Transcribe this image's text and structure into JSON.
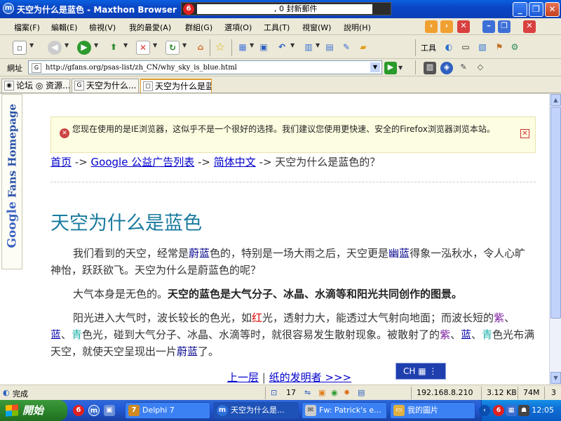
{
  "window": {
    "title": "天空为什么是蓝色 - Maxthon Browser",
    "mail_widget_text": ", 0 封新郵件"
  },
  "menu": {
    "items": [
      "檔案(F)",
      "編輯(E)",
      "檢視(V)",
      "我的最愛(A)",
      "群組(G)",
      "選項(O)",
      "工具(T)",
      "視窗(W)",
      "說明(H)"
    ]
  },
  "toolbar": {
    "tools_label": "工具"
  },
  "address": {
    "label": "網址",
    "url": "http://gfans.org/psas-list/zh_CN/why_sky_is_blue.html"
  },
  "tabs": [
    {
      "label": "论坛 ◎ 资源..."
    },
    {
      "label": "天空为什么..."
    },
    {
      "label": "天空为什么是蓝..."
    }
  ],
  "page": {
    "sidebar_logo_word": "Google",
    "sidebar_logo_rest": " Fans Homepage",
    "ie_warning": "您现在使用的是IE浏览器，这似乎不是一个很好的选择。我们建议您使用更快速、安全的Firefox浏览器浏览本站。",
    "breadcrumb": {
      "home": "首页",
      "arrow": " -> ",
      "list": "Google 公益广告列表",
      "lang": "简体中文",
      "current": "天空为什么是蓝色的？"
    },
    "title": "天空为什么是蓝色",
    "paragraph1": {
      "a": "我们看到的天空，经常是",
      "b": "蔚蓝",
      "c": "色的，特别是一场大雨之后，天空更是",
      "d": "幽蓝",
      "e": "得象一泓秋水，令人心旷神怡，跃跃欲飞。天空为什么是蔚蓝色的呢？"
    },
    "paragraph2": {
      "a": "大气本身是无色的。",
      "b": "天空的",
      "c": "蓝",
      "d": "色是大气分子、冰晶、水滴等和阳光共同创作的图景。"
    },
    "paragraph3": {
      "a": "阳光进入大气时，波长较长的色光，如",
      "b": "红",
      "c": "光，透射力大，能透过大气射向地面；而波长短的",
      "d": "紫",
      "e": "、",
      "f": "蓝",
      "g": "、",
      "h": "青",
      "i": "色光，碰到大气分子、冰晶、水滴等时，就很容易发生散射现象。被散射了的",
      "j": "紫",
      "k": "、",
      "l": "蓝",
      "m": "、",
      "n": "青",
      "o": "色光布满天空，就使天空呈现出一片",
      "p": "蔚蓝",
      "q": "了。"
    },
    "pager": {
      "prev": "上一层",
      "sep": " | ",
      "next": "纸的发明者 >>>"
    },
    "ime": "CH"
  },
  "status": {
    "text": "完成",
    "count": "17",
    "ip": "192.168.8.210",
    "size": "3.12 KB",
    "memory": "74M",
    "tabs": "3"
  },
  "taskbar": {
    "start": "開始",
    "buttons": [
      {
        "label": "Delphi 7"
      },
      {
        "label": "天空为什么是..."
      },
      {
        "label": "Fw: Patrick's e..."
      },
      {
        "label": "我的圖片"
      }
    ],
    "clock": "12:05"
  },
  "colors": {
    "title_gradient": "#0a46c4",
    "page_title": "#1a7a9e",
    "link": "#0000cc",
    "taskbar": "#245edb",
    "start": "#2f8a2f"
  }
}
